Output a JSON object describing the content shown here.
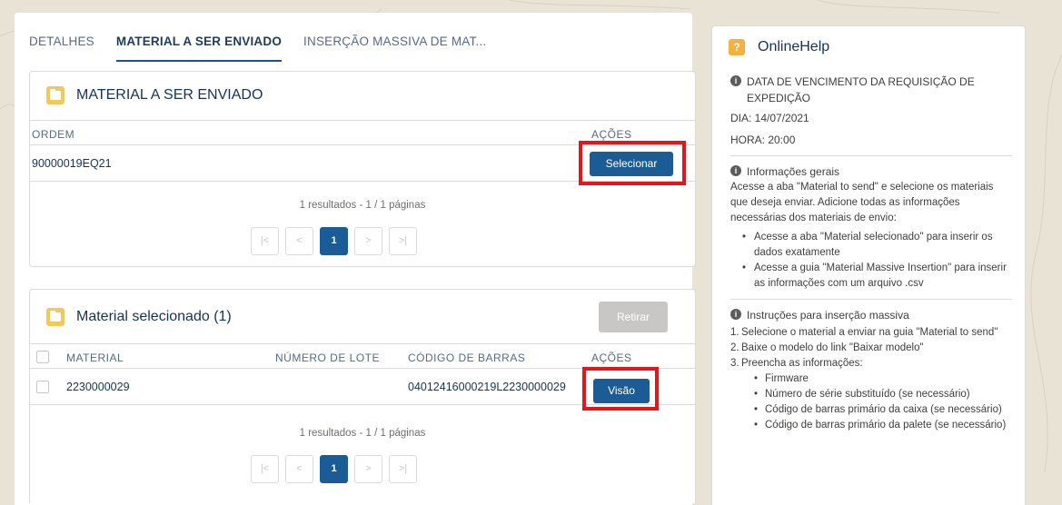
{
  "tabs": [
    {
      "label": "DETALHES"
    },
    {
      "label": "MATERIAL A SER ENVIADO"
    },
    {
      "label": "INSERÇÃO MASSIVA DE MAT..."
    }
  ],
  "card1": {
    "title": "MATERIAL A SER ENVIADO",
    "col_ordem": "ORDEM",
    "col_acoes": "AÇÕES",
    "row_ordem": "90000019EQ21",
    "select_button": "Selecionar",
    "results": "1 resultados - 1 / 1 páginas",
    "pager": {
      "first": "|<",
      "prev": "<",
      "page": "1",
      "next": ">",
      "last": ">|"
    }
  },
  "card2": {
    "title": "Material selecionado (1)",
    "remove_button": "Retirar",
    "col_material": "MATERIAL",
    "col_lote": "NÚMERO DE LOTE",
    "col_barras": "CÓDIGO DE BARRAS",
    "col_acoes": "AÇÕES",
    "row_material": "2230000029",
    "row_lote": "",
    "row_barras": "04012416000219L2230000029",
    "view_button": "Visão",
    "results": "1 resultados - 1 / 1 páginas",
    "pager": {
      "first": "|<",
      "prev": "<",
      "page": "1",
      "next": ">",
      "last": ">|"
    }
  },
  "help": {
    "title": "OnlineHelp",
    "due_title": "DATA DE VENCIMENTO DA REQUISIÇÃO DE EXPEDIÇÃO",
    "due_day": "DIA: 14/07/2021",
    "due_hour": "HORA: 20:00",
    "general_title": "Informações gerais",
    "general_text": "Acesse a aba \"Material to send\" e selecione os materiais que deseja enviar. Adicione todas as informações necessárias dos materiais de envio:",
    "general_items": [
      "Acesse a aba \"Material selecionado\" para inserir os dados exatamente",
      "Acesse a guia \"Material Massive Insertion\" para inserir as informações com um arquivo .csv"
    ],
    "mass_title": "Instruções para inserção massiva",
    "mass_steps": [
      {
        "num": "1.",
        "text": "Selecione o material a enviar na guia \"Material to send\""
      },
      {
        "num": "2.",
        "text": "Baixe o modelo do link \"Baixar modelo\""
      },
      {
        "num": "3.",
        "text": "Preencha as informações:"
      }
    ],
    "mass_sub": [
      "Firmware",
      "Número de série substituído (se necessário)",
      "Código de barras primário da caixa (se necessário)",
      "Código de barras primário da palete (se necessário)"
    ]
  },
  "colors": {
    "accent": "#1b5c96",
    "highlight": "#e3161b",
    "folder": "#f5c65a",
    "help_icon": "#f5b140"
  }
}
